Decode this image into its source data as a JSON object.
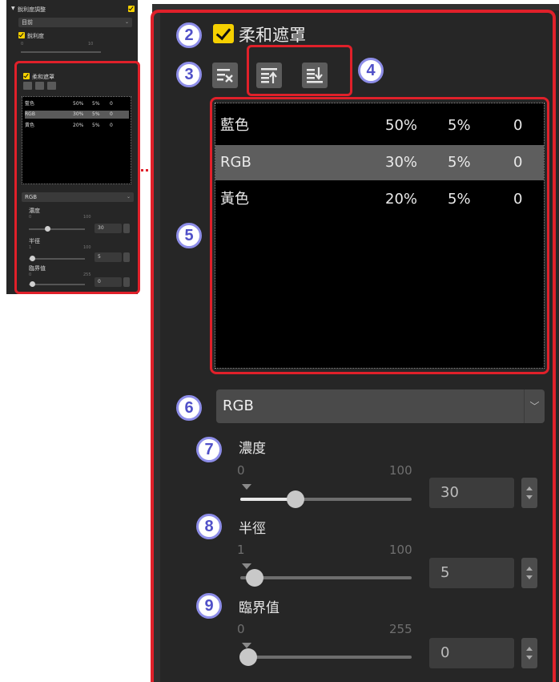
{
  "thumbnail": {
    "section_title": "銳利度調整",
    "preset_select": "目前",
    "sharpness_label": "銳利度",
    "sharpness_ticks": [
      "0",
      "10"
    ],
    "unsharp_label": "柔和遮罩",
    "rows": [
      {
        "name": "藍色",
        "intensity": "50%",
        "radius": "5%",
        "threshold": "0"
      },
      {
        "name": "RGB",
        "intensity": "30%",
        "radius": "5%",
        "threshold": "0"
      },
      {
        "name": "黃色",
        "intensity": "20%",
        "radius": "5%",
        "threshold": "0"
      }
    ],
    "channel_select": "RGB",
    "intensity_label": "濃度",
    "intensity_ticks": [
      "0",
      "100"
    ],
    "intensity_value": "30",
    "radius_label": "半徑",
    "radius_ticks": [
      "1",
      "100"
    ],
    "radius_value": "5",
    "threshold_label": "臨界值",
    "threshold_ticks": [
      "0",
      "255"
    ],
    "threshold_value": "0"
  },
  "panel": {
    "unsharp_label": "柔和遮罩",
    "unsharp_checked": true,
    "rows": [
      {
        "name": "藍色",
        "intensity": "50%",
        "radius": "5%",
        "threshold": "0",
        "selected": false
      },
      {
        "name": "RGB",
        "intensity": "30%",
        "radius": "5%",
        "threshold": "0",
        "selected": true
      },
      {
        "name": "黃色",
        "intensity": "20%",
        "radius": "5%",
        "threshold": "0",
        "selected": false
      }
    ],
    "channel_select": "RGB",
    "intensity": {
      "label": "濃度",
      "min": "0",
      "max": "100",
      "value": "30",
      "level": 0.3
    },
    "radius": {
      "label": "半徑",
      "min": "1",
      "max": "100",
      "value": "5",
      "level": 0.04
    },
    "threshold": {
      "label": "臨界值",
      "min": "0",
      "max": "255",
      "value": "0",
      "level": 0.0
    }
  },
  "callouts": [
    "2",
    "3",
    "4",
    "5",
    "6",
    "7",
    "8",
    "9"
  ],
  "colors": {
    "highlight": "#e0202a",
    "callout_ring": "#8d8de8",
    "checkbox": "#f5d000",
    "panel_bg": "#262626",
    "list_bg": "#000000"
  },
  "icons": {
    "delete": "delete-item-icon",
    "move_up": "move-up-icon",
    "move_down": "move-down-icon"
  }
}
